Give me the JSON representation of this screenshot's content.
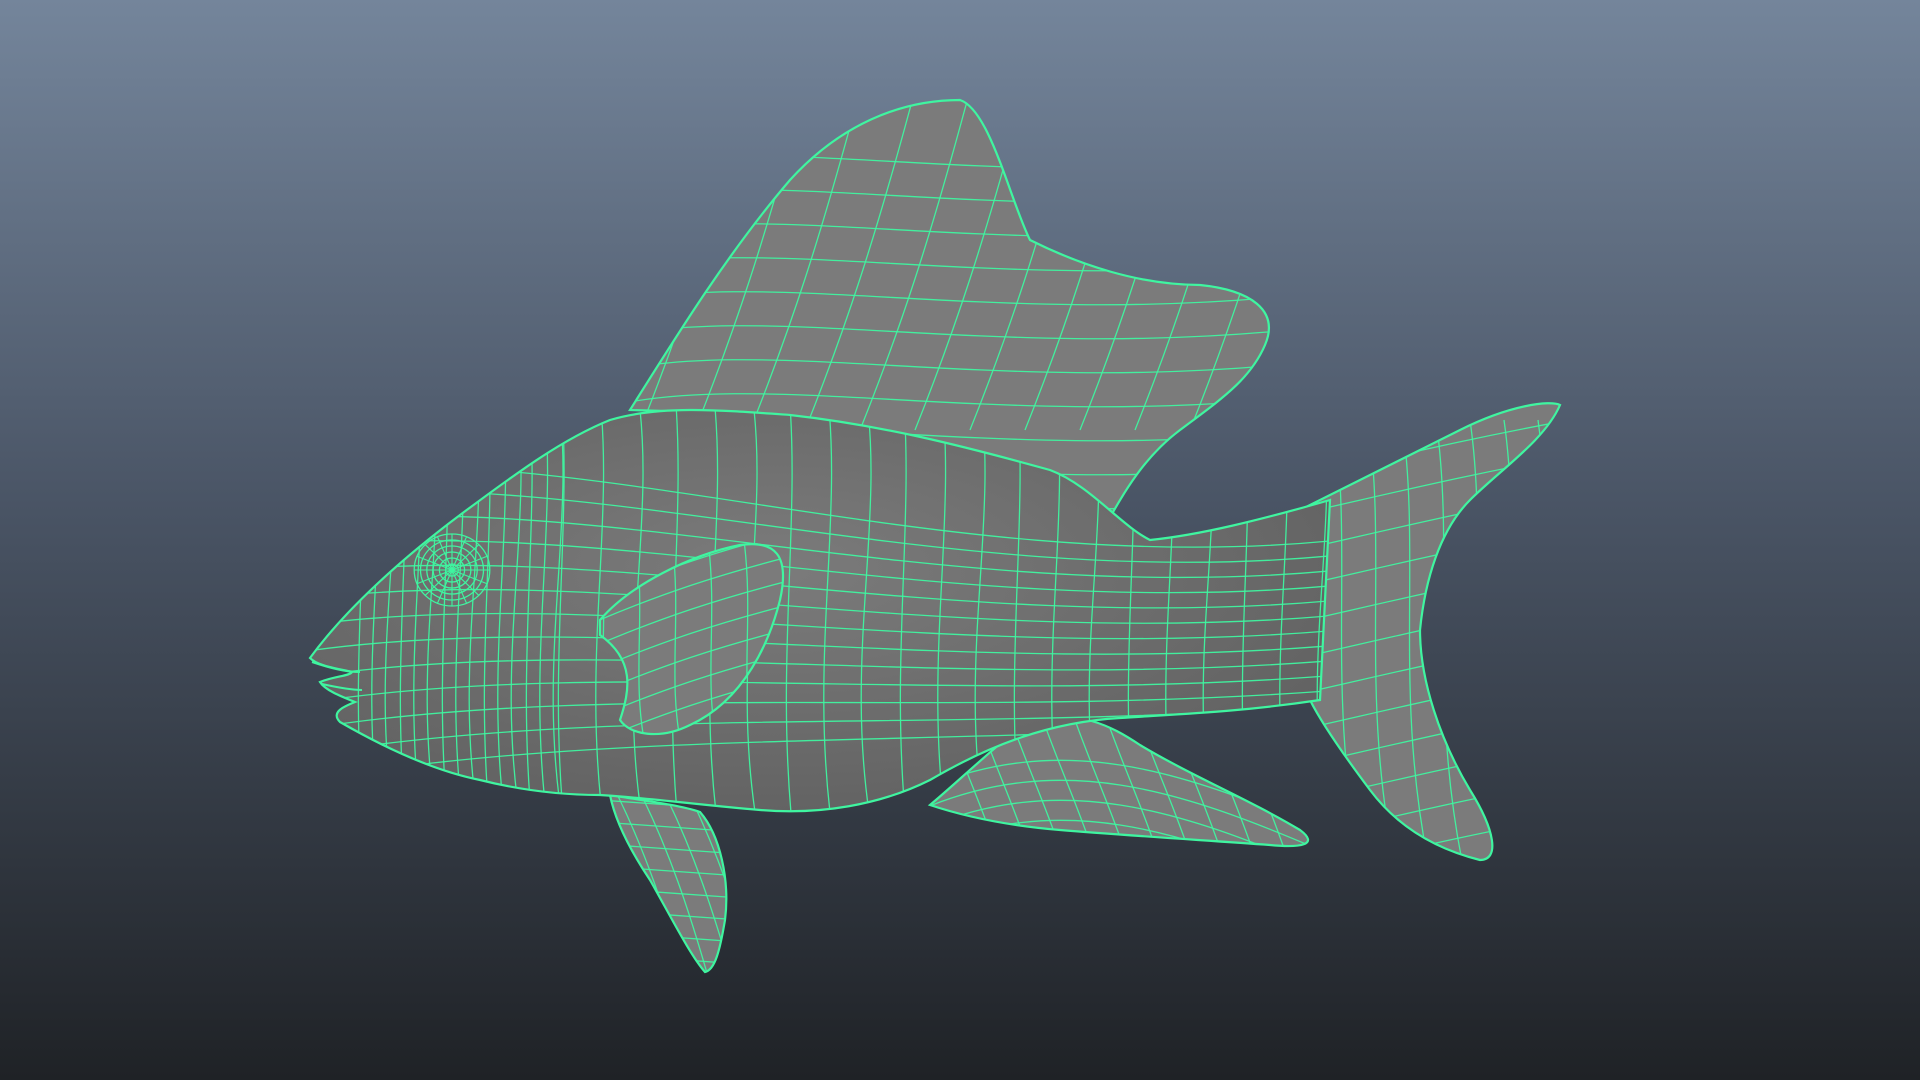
{
  "viewport": {
    "background_top": "#74859b",
    "background_middle": "#4b5667",
    "background_bottom": "#1f2226"
  },
  "model": {
    "name": "fish-mesh",
    "display_mode": "wireframe-on-shaded",
    "shade_color": "#7b7b7b",
    "shade_dark": "#5f5f5f",
    "wire_color": "#3ff5a0"
  }
}
